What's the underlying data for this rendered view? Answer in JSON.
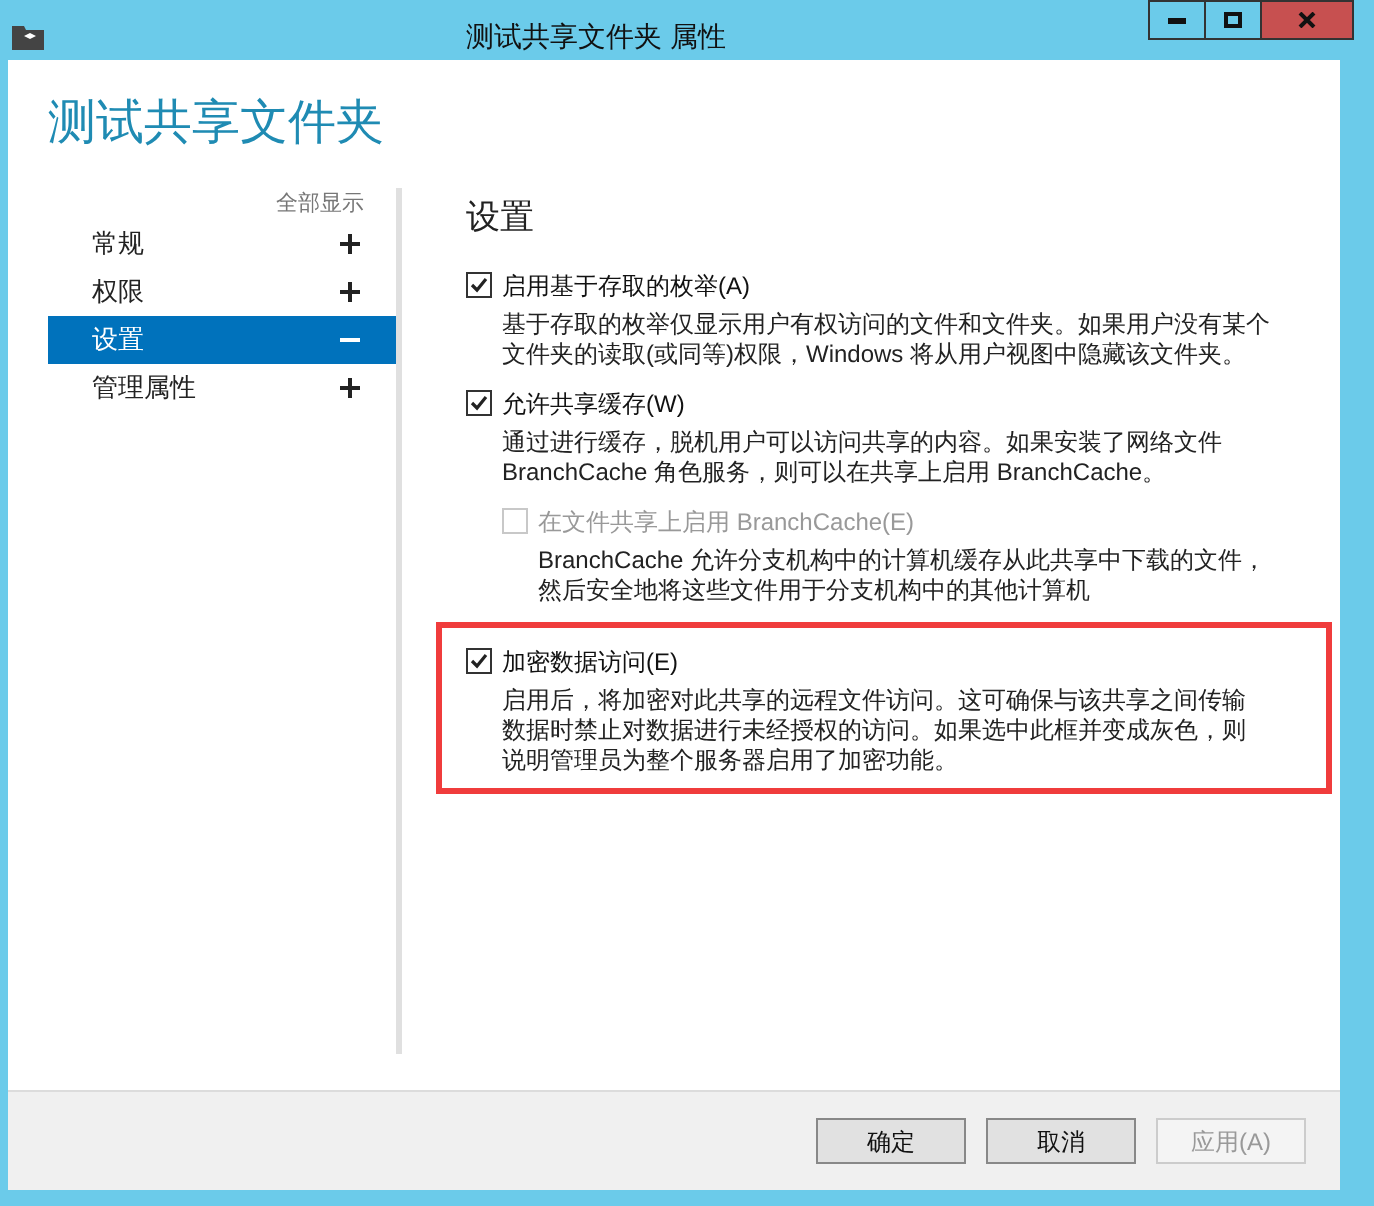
{
  "window": {
    "title": "测试共享文件夹 属性"
  },
  "heading": "测试共享文件夹",
  "sidebar": {
    "show_all": "全部显示",
    "items": [
      {
        "label": "常规",
        "expanded": false,
        "selected": false
      },
      {
        "label": "权限",
        "expanded": false,
        "selected": false
      },
      {
        "label": "设置",
        "expanded": true,
        "selected": true
      },
      {
        "label": "管理属性",
        "expanded": false,
        "selected": false
      }
    ]
  },
  "section_title": "设置",
  "options": [
    {
      "label": "启用基于存取的枚举(A)",
      "checked": true,
      "disabled": false,
      "highlighted": false,
      "description": "基于存取的枚举仅显示用户有权访问的文件和文件夹。如果用户没有某个文件夹的读取(或同等)权限，Windows 将从用户视图中隐藏该文件夹。",
      "nested": false
    },
    {
      "label": "允许共享缓存(W)",
      "checked": true,
      "disabled": false,
      "highlighted": false,
      "description": "通过进行缓存，脱机用户可以访问共享的内容。如果安装了网络文件 BranchCache 角色服务，则可以在共享上启用 BranchCache。",
      "nested": false
    },
    {
      "label": "在文件共享上启用 BranchCache(E)",
      "checked": false,
      "disabled": true,
      "highlighted": false,
      "description": "BranchCache 允许分支机构中的计算机缓存从此共享中下载的文件，然后安全地将这些文件用于分支机构中的其他计算机",
      "nested": true
    },
    {
      "label": "加密数据访问(E)",
      "checked": true,
      "disabled": false,
      "highlighted": true,
      "description": "启用后，将加密对此共享的远程文件访问。这可确保与该共享之间传输数据时禁止对数据进行未经授权的访问。如果选中此框并变成灰色，则说明管理员为整个服务器启用了加密功能。",
      "nested": false
    }
  ],
  "buttons": [
    {
      "label": "确定",
      "disabled": false
    },
    {
      "label": "取消",
      "disabled": false
    },
    {
      "label": "应用(A)",
      "disabled": true
    }
  ]
}
